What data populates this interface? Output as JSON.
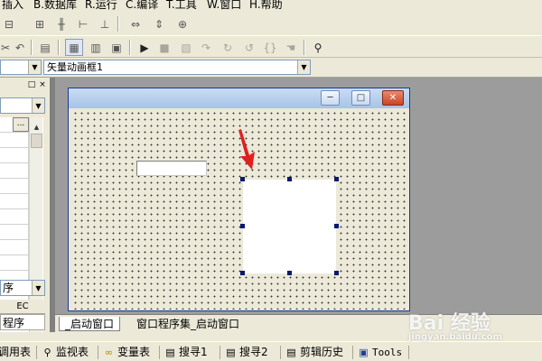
{
  "menubar": {
    "items": [
      {
        "label": "插入"
      },
      {
        "label": "B.数据库"
      },
      {
        "label": "R.运行"
      },
      {
        "label": "C.编译"
      },
      {
        "label": "T.工具"
      },
      {
        "label": "W.窗口"
      },
      {
        "label": "H.帮助"
      }
    ]
  },
  "combos": {
    "left_value": "",
    "object_value": "矢量动画框1"
  },
  "left_panel": {
    "pin_glyph": "□",
    "close_glyph": "×",
    "dots_label": "...",
    "bottom_combo_value": "序",
    "ec_label": "EC",
    "tab_label": "程序"
  },
  "form_window": {
    "min_glyph": "─",
    "max_glyph": "□",
    "close_glyph": "✕"
  },
  "annotation": {
    "arrow_color": "#e02020"
  },
  "tabs": {
    "startup": "_启动窗口",
    "program_set": "窗口程序集_启动窗口"
  },
  "bottom_tabs": [
    {
      "label": "调用表",
      "icon": ""
    },
    {
      "label": "监视表",
      "icon": "magnifier-icon"
    },
    {
      "label": "变量表",
      "icon": "glasses-icon"
    },
    {
      "label": "搜寻1",
      "icon": "search-list-icon"
    },
    {
      "label": "搜寻2",
      "icon": "search-list-icon"
    },
    {
      "label": "剪辑历史",
      "icon": "clipboard-icon"
    },
    {
      "label": "Tools",
      "icon": "window-icon"
    }
  ],
  "watermark": {
    "text": "Bai 经验",
    "sub": "jingyan.baidu.com"
  },
  "colors": {
    "titlebar": "#a6c3e8",
    "handle": "#0a1a6e",
    "workspace": "#9c9c9c"
  }
}
